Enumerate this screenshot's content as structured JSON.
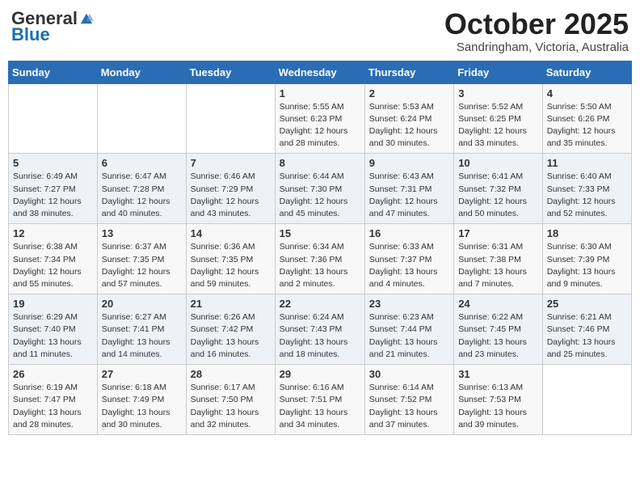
{
  "header": {
    "logo_general": "General",
    "logo_blue": "Blue",
    "month_title": "October 2025",
    "location": "Sandringham, Victoria, Australia"
  },
  "weekdays": [
    "Sunday",
    "Monday",
    "Tuesday",
    "Wednesday",
    "Thursday",
    "Friday",
    "Saturday"
  ],
  "weeks": [
    [
      {
        "day": "",
        "sunrise": "",
        "sunset": "",
        "daylight": ""
      },
      {
        "day": "",
        "sunrise": "",
        "sunset": "",
        "daylight": ""
      },
      {
        "day": "",
        "sunrise": "",
        "sunset": "",
        "daylight": ""
      },
      {
        "day": "1",
        "sunrise": "Sunrise: 5:55 AM",
        "sunset": "Sunset: 6:23 PM",
        "daylight": "Daylight: 12 hours and 28 minutes."
      },
      {
        "day": "2",
        "sunrise": "Sunrise: 5:53 AM",
        "sunset": "Sunset: 6:24 PM",
        "daylight": "Daylight: 12 hours and 30 minutes."
      },
      {
        "day": "3",
        "sunrise": "Sunrise: 5:52 AM",
        "sunset": "Sunset: 6:25 PM",
        "daylight": "Daylight: 12 hours and 33 minutes."
      },
      {
        "day": "4",
        "sunrise": "Sunrise: 5:50 AM",
        "sunset": "Sunset: 6:26 PM",
        "daylight": "Daylight: 12 hours and 35 minutes."
      }
    ],
    [
      {
        "day": "5",
        "sunrise": "Sunrise: 6:49 AM",
        "sunset": "Sunset: 7:27 PM",
        "daylight": "Daylight: 12 hours and 38 minutes."
      },
      {
        "day": "6",
        "sunrise": "Sunrise: 6:47 AM",
        "sunset": "Sunset: 7:28 PM",
        "daylight": "Daylight: 12 hours and 40 minutes."
      },
      {
        "day": "7",
        "sunrise": "Sunrise: 6:46 AM",
        "sunset": "Sunset: 7:29 PM",
        "daylight": "Daylight: 12 hours and 43 minutes."
      },
      {
        "day": "8",
        "sunrise": "Sunrise: 6:44 AM",
        "sunset": "Sunset: 7:30 PM",
        "daylight": "Daylight: 12 hours and 45 minutes."
      },
      {
        "day": "9",
        "sunrise": "Sunrise: 6:43 AM",
        "sunset": "Sunset: 7:31 PM",
        "daylight": "Daylight: 12 hours and 47 minutes."
      },
      {
        "day": "10",
        "sunrise": "Sunrise: 6:41 AM",
        "sunset": "Sunset: 7:32 PM",
        "daylight": "Daylight: 12 hours and 50 minutes."
      },
      {
        "day": "11",
        "sunrise": "Sunrise: 6:40 AM",
        "sunset": "Sunset: 7:33 PM",
        "daylight": "Daylight: 12 hours and 52 minutes."
      }
    ],
    [
      {
        "day": "12",
        "sunrise": "Sunrise: 6:38 AM",
        "sunset": "Sunset: 7:34 PM",
        "daylight": "Daylight: 12 hours and 55 minutes."
      },
      {
        "day": "13",
        "sunrise": "Sunrise: 6:37 AM",
        "sunset": "Sunset: 7:35 PM",
        "daylight": "Daylight: 12 hours and 57 minutes."
      },
      {
        "day": "14",
        "sunrise": "Sunrise: 6:36 AM",
        "sunset": "Sunset: 7:35 PM",
        "daylight": "Daylight: 12 hours and 59 minutes."
      },
      {
        "day": "15",
        "sunrise": "Sunrise: 6:34 AM",
        "sunset": "Sunset: 7:36 PM",
        "daylight": "Daylight: 13 hours and 2 minutes."
      },
      {
        "day": "16",
        "sunrise": "Sunrise: 6:33 AM",
        "sunset": "Sunset: 7:37 PM",
        "daylight": "Daylight: 13 hours and 4 minutes."
      },
      {
        "day": "17",
        "sunrise": "Sunrise: 6:31 AM",
        "sunset": "Sunset: 7:38 PM",
        "daylight": "Daylight: 13 hours and 7 minutes."
      },
      {
        "day": "18",
        "sunrise": "Sunrise: 6:30 AM",
        "sunset": "Sunset: 7:39 PM",
        "daylight": "Daylight: 13 hours and 9 minutes."
      }
    ],
    [
      {
        "day": "19",
        "sunrise": "Sunrise: 6:29 AM",
        "sunset": "Sunset: 7:40 PM",
        "daylight": "Daylight: 13 hours and 11 minutes."
      },
      {
        "day": "20",
        "sunrise": "Sunrise: 6:27 AM",
        "sunset": "Sunset: 7:41 PM",
        "daylight": "Daylight: 13 hours and 14 minutes."
      },
      {
        "day": "21",
        "sunrise": "Sunrise: 6:26 AM",
        "sunset": "Sunset: 7:42 PM",
        "daylight": "Daylight: 13 hours and 16 minutes."
      },
      {
        "day": "22",
        "sunrise": "Sunrise: 6:24 AM",
        "sunset": "Sunset: 7:43 PM",
        "daylight": "Daylight: 13 hours and 18 minutes."
      },
      {
        "day": "23",
        "sunrise": "Sunrise: 6:23 AM",
        "sunset": "Sunset: 7:44 PM",
        "daylight": "Daylight: 13 hours and 21 minutes."
      },
      {
        "day": "24",
        "sunrise": "Sunrise: 6:22 AM",
        "sunset": "Sunset: 7:45 PM",
        "daylight": "Daylight: 13 hours and 23 minutes."
      },
      {
        "day": "25",
        "sunrise": "Sunrise: 6:21 AM",
        "sunset": "Sunset: 7:46 PM",
        "daylight": "Daylight: 13 hours and 25 minutes."
      }
    ],
    [
      {
        "day": "26",
        "sunrise": "Sunrise: 6:19 AM",
        "sunset": "Sunset: 7:47 PM",
        "daylight": "Daylight: 13 hours and 28 minutes."
      },
      {
        "day": "27",
        "sunrise": "Sunrise: 6:18 AM",
        "sunset": "Sunset: 7:49 PM",
        "daylight": "Daylight: 13 hours and 30 minutes."
      },
      {
        "day": "28",
        "sunrise": "Sunrise: 6:17 AM",
        "sunset": "Sunset: 7:50 PM",
        "daylight": "Daylight: 13 hours and 32 minutes."
      },
      {
        "day": "29",
        "sunrise": "Sunrise: 6:16 AM",
        "sunset": "Sunset: 7:51 PM",
        "daylight": "Daylight: 13 hours and 34 minutes."
      },
      {
        "day": "30",
        "sunrise": "Sunrise: 6:14 AM",
        "sunset": "Sunset: 7:52 PM",
        "daylight": "Daylight: 13 hours and 37 minutes."
      },
      {
        "day": "31",
        "sunrise": "Sunrise: 6:13 AM",
        "sunset": "Sunset: 7:53 PM",
        "daylight": "Daylight: 13 hours and 39 minutes."
      },
      {
        "day": "",
        "sunrise": "",
        "sunset": "",
        "daylight": ""
      }
    ]
  ]
}
